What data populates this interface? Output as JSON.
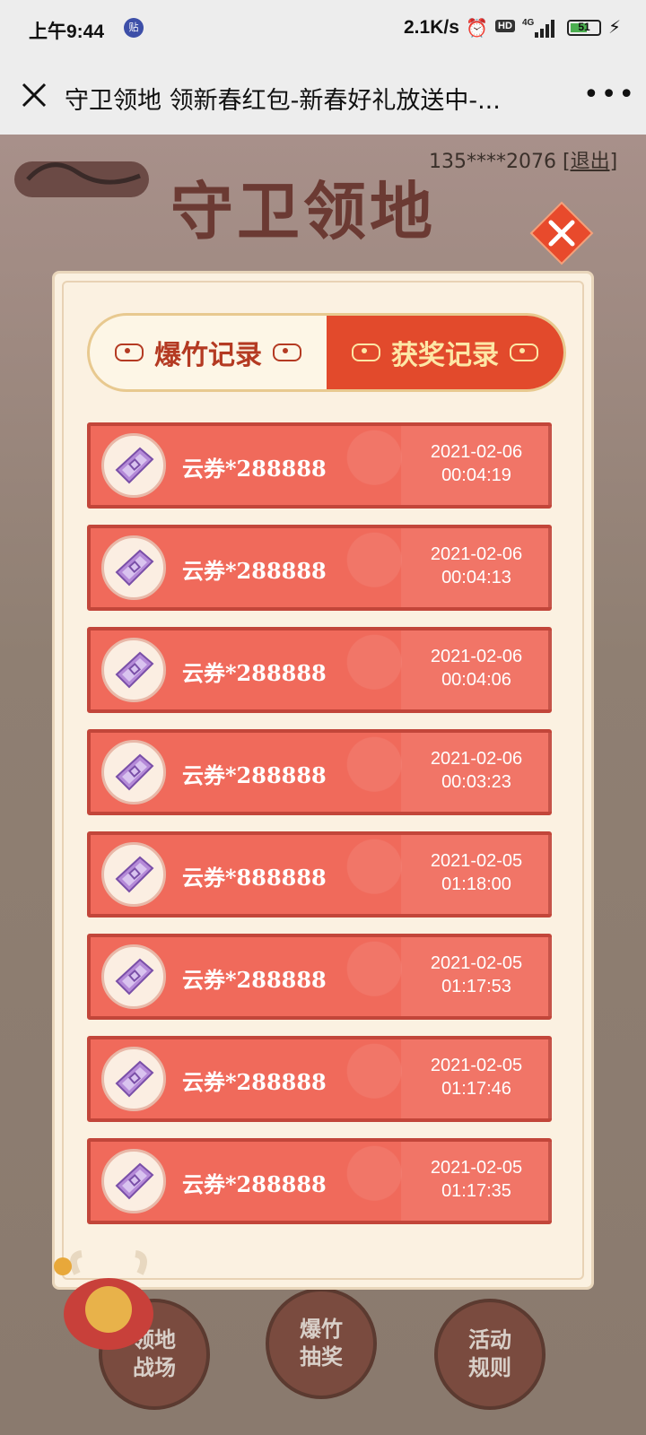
{
  "status_bar": {
    "time": "上午9:44",
    "notif_badge": "贴",
    "net_speed": "2.1K/s",
    "hd_label": "HD",
    "network": "4G",
    "battery": "51"
  },
  "title_bar": {
    "title": "守卫领地 领新春红包-新春好礼放送中-...",
    "more": "•••"
  },
  "background": {
    "big_title": "守卫领地",
    "user_masked": "135****2076",
    "logout_label": "[退出]",
    "buttons": [
      {
        "label": "领地\n战场"
      },
      {
        "label": "爆竹\n抽奖"
      },
      {
        "label": "活动\n规则"
      }
    ]
  },
  "modal": {
    "tabs": [
      {
        "label": "爆竹记录",
        "active": false
      },
      {
        "label": "获奖记录",
        "active": true
      }
    ],
    "records": [
      {
        "prize": "云券*288888",
        "date": "2021-02-06",
        "time": "00:04:19"
      },
      {
        "prize": "云券*288888",
        "date": "2021-02-06",
        "time": "00:04:13"
      },
      {
        "prize": "云券*288888",
        "date": "2021-02-06",
        "time": "00:04:06"
      },
      {
        "prize": "云券*288888",
        "date": "2021-02-06",
        "time": "00:03:23"
      },
      {
        "prize": "云券*888888",
        "date": "2021-02-05",
        "time": "01:18:00"
      },
      {
        "prize": "云券*288888",
        "date": "2021-02-05",
        "time": "01:17:53"
      },
      {
        "prize": "云券*288888",
        "date": "2021-02-05",
        "time": "01:17:46"
      },
      {
        "prize": "云券*288888",
        "date": "2021-02-05",
        "time": "01:17:35"
      }
    ]
  },
  "colors": {
    "accent": "#e24a2c",
    "record_bg": "#f06a5b",
    "modal_bg": "#fbf1e1"
  }
}
